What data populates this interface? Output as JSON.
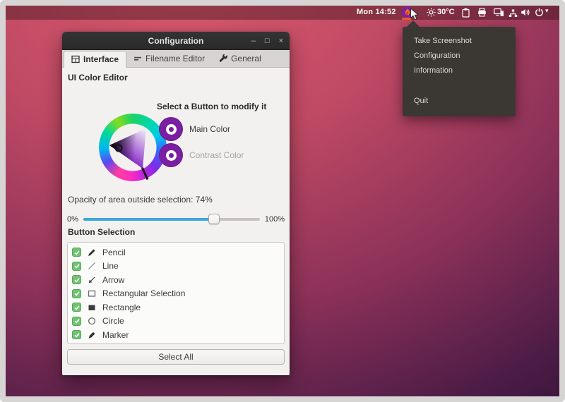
{
  "desktop": {
    "panel": {
      "clock": "Mon 14:52",
      "temperature": "30°C"
    },
    "tray_menu": {
      "items": [
        {
          "label": "Take Screenshot"
        },
        {
          "label": "Configuration"
        },
        {
          "label": "Information"
        },
        {
          "label": "Quit"
        }
      ]
    }
  },
  "window": {
    "title": "Configuration",
    "controls": {
      "minimize": "–",
      "maximize": "□",
      "close": "×"
    },
    "tabs": [
      {
        "label": "Interface",
        "active": true
      },
      {
        "label": "Filename Editor",
        "active": false
      },
      {
        "label": "General",
        "active": false
      }
    ],
    "ui_color_editor": {
      "heading": "UI Color Editor",
      "prompt": "Select a Button to modify it",
      "buttons": [
        {
          "label": "Main Color",
          "enabled": true
        },
        {
          "label": "Contrast Color",
          "enabled": false
        }
      ]
    },
    "opacity": {
      "label": "Opacity of area outside selection: 74%",
      "value_percent": 74,
      "min_label": "0%",
      "max_label": "100%"
    },
    "button_selection": {
      "heading": "Button Selection",
      "items": [
        {
          "label": "Pencil",
          "checked": true
        },
        {
          "label": "Line",
          "checked": true
        },
        {
          "label": "Arrow",
          "checked": true
        },
        {
          "label": "Rectangular Selection",
          "checked": true
        },
        {
          "label": "Rectangle",
          "checked": true
        },
        {
          "label": "Circle",
          "checked": true
        },
        {
          "label": "Marker",
          "checked": true
        }
      ],
      "select_all_label": "Select All"
    }
  },
  "colors": {
    "slider_accent_blue": "#39a7dd",
    "checkbox_green": "#71c371",
    "color_button_purple": "#7b1fa2",
    "flame_orange": "#f0730f",
    "menu_background": "#3b3733",
    "panel_tint_red": "#a04a52"
  }
}
